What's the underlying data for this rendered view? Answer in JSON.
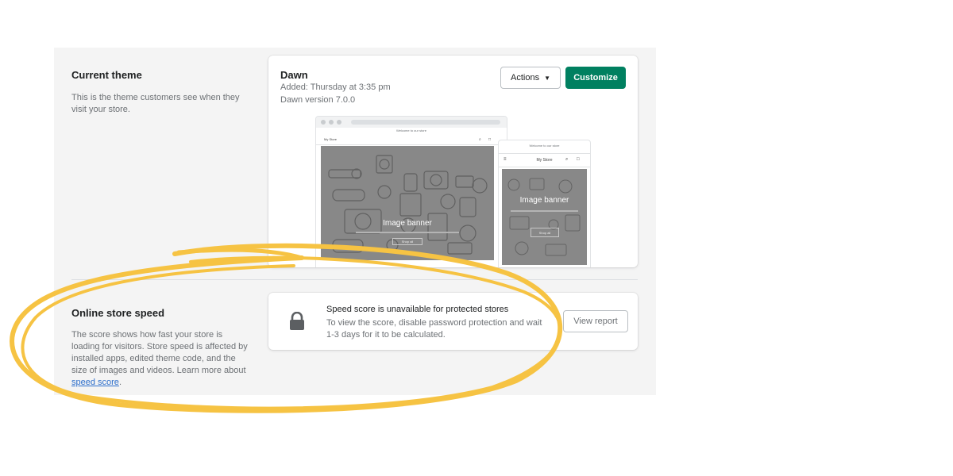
{
  "current_theme": {
    "section_title": "Current theme",
    "section_description": "This is the theme customers see when they visit your store.",
    "theme_name": "Dawn",
    "added": "Added: Thursday at 3:35 pm",
    "version": "Dawn version 7.0.0",
    "actions_label": "Actions",
    "customize_label": "Customize",
    "preview": {
      "announcement": "Welcome to our store",
      "store_name": "My Store",
      "banner_title": "Image banner",
      "banner_button": "Shop all"
    }
  },
  "online_store_speed": {
    "section_title": "Online store speed",
    "section_description": "The score shows how fast your store is loading for visitors. Store speed is affected by installed apps, edited theme code, and the size of images and videos. Learn more about",
    "link_text": "speed score",
    "link_suffix": ".",
    "card_title": "Speed score is unavailable for protected stores",
    "card_text": "To view the score, disable password protection and wait 1-3 days for it to be calculated.",
    "view_report_label": "View report"
  },
  "colors": {
    "primary": "#008060",
    "annotation": "#f6c343",
    "banner": "#888888"
  },
  "icons": {
    "lock": "lock-icon",
    "dropdown": "caret-down-icon",
    "search": "search-icon",
    "cart": "cart-icon",
    "menu": "menu-icon"
  }
}
